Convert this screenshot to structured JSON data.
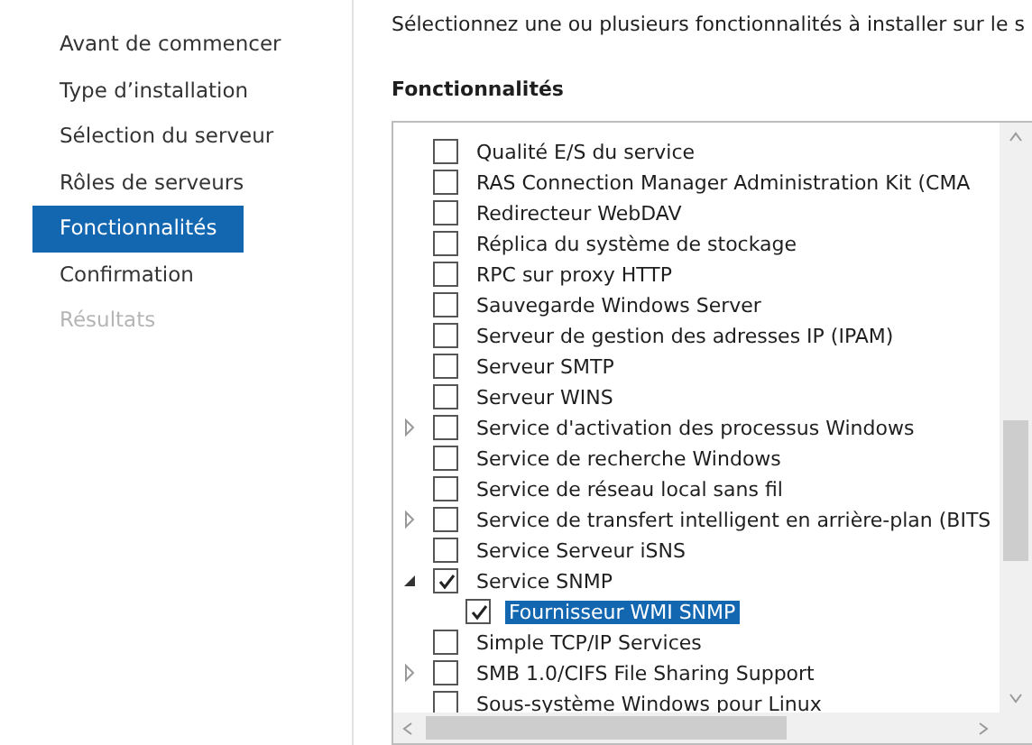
{
  "sidebar": {
    "items": [
      {
        "label": "Avant de commencer",
        "selected": false,
        "disabled": false
      },
      {
        "label": "Type d’installation",
        "selected": false,
        "disabled": false
      },
      {
        "label": "Sélection du serveur",
        "selected": false,
        "disabled": false
      },
      {
        "label": "Rôles de serveurs",
        "selected": false,
        "disabled": false
      },
      {
        "label": "Fonctionnalités",
        "selected": true,
        "disabled": false
      },
      {
        "label": "Confirmation",
        "selected": false,
        "disabled": false
      },
      {
        "label": "Résultats",
        "selected": false,
        "disabled": true
      }
    ]
  },
  "instruction": "Sélectionnez une ou plusieurs fonctionnalités à installer sur le s",
  "features": {
    "heading": "Fonctionnalités",
    "items": [
      {
        "kind": "leaf",
        "label": "Qualité E/S du service",
        "checked": false,
        "selected": false
      },
      {
        "kind": "leaf",
        "label": "RAS Connection Manager Administration Kit (CMA",
        "checked": false,
        "selected": false
      },
      {
        "kind": "leaf",
        "label": "Redirecteur WebDAV",
        "checked": false,
        "selected": false
      },
      {
        "kind": "leaf",
        "label": "Réplica du système de stockage",
        "checked": false,
        "selected": false
      },
      {
        "kind": "leaf",
        "label": "RPC sur proxy HTTP",
        "checked": false,
        "selected": false
      },
      {
        "kind": "leaf",
        "label": "Sauvegarde Windows Server",
        "checked": false,
        "selected": false
      },
      {
        "kind": "leaf",
        "label": "Serveur de gestion des adresses IP (IPAM)",
        "checked": false,
        "selected": false
      },
      {
        "kind": "leaf",
        "label": "Serveur SMTP",
        "checked": false,
        "selected": false
      },
      {
        "kind": "leaf",
        "label": "Serveur WINS",
        "checked": false,
        "selected": false
      },
      {
        "kind": "group",
        "label": "Service d'activation des processus Windows",
        "checked": false,
        "selected": false,
        "expanded": false
      },
      {
        "kind": "leaf",
        "label": "Service de recherche Windows",
        "checked": false,
        "selected": false
      },
      {
        "kind": "leaf",
        "label": "Service de réseau local sans fil",
        "checked": false,
        "selected": false
      },
      {
        "kind": "group",
        "label": "Service de transfert intelligent en arrière-plan (BITS",
        "checked": false,
        "selected": false,
        "expanded": false
      },
      {
        "kind": "leaf",
        "label": "Service Serveur iSNS",
        "checked": false,
        "selected": false
      },
      {
        "kind": "group",
        "label": "Service SNMP",
        "checked": true,
        "selected": false,
        "expanded": true,
        "children": [
          {
            "label": "Fournisseur WMI SNMP",
            "checked": true,
            "selected": true
          }
        ]
      },
      {
        "kind": "leaf",
        "label": "Simple TCP/IP Services",
        "checked": false,
        "selected": false
      },
      {
        "kind": "group",
        "label": "SMB 1.0/CIFS File Sharing Support",
        "checked": false,
        "selected": false,
        "expanded": false
      },
      {
        "kind": "leaf",
        "label": "Sous-système Windows pour Linux",
        "checked": false,
        "selected": false
      }
    ]
  }
}
